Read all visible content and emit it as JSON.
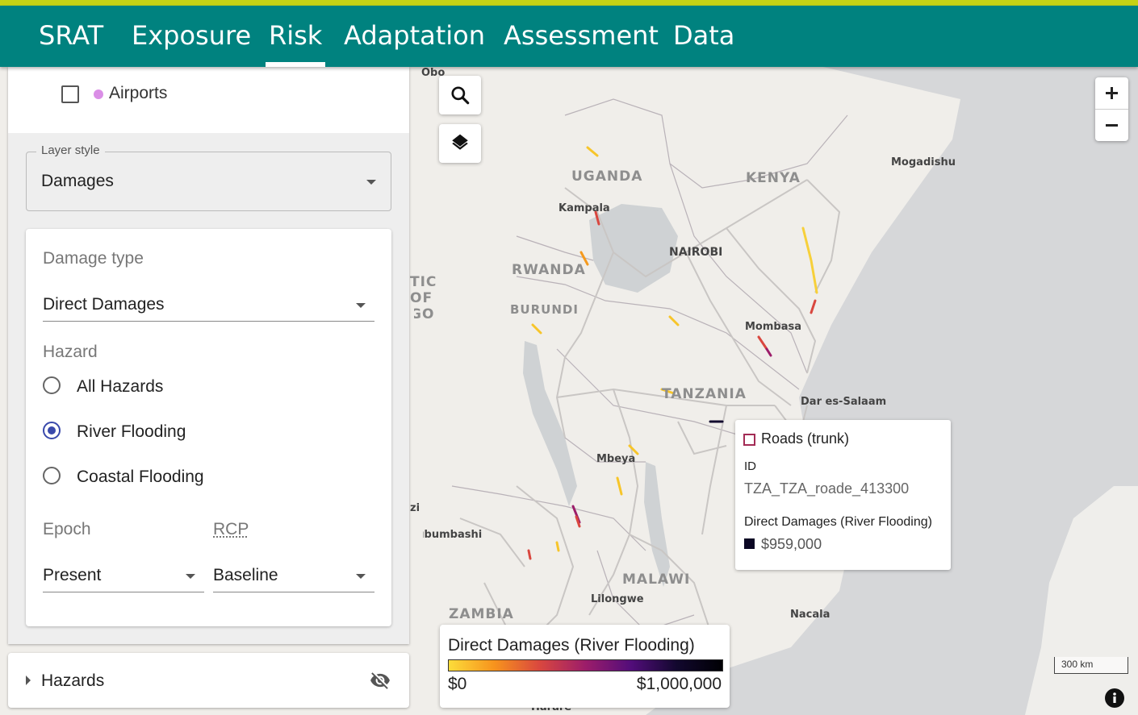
{
  "nav": {
    "items": [
      {
        "label": "SRAT"
      },
      {
        "label": "Exposure"
      },
      {
        "label": "Risk",
        "active": true
      },
      {
        "label": "Adaptation"
      },
      {
        "label": "Assessment"
      },
      {
        "label": "Data"
      }
    ]
  },
  "sidebar": {
    "airports_label": "Airports",
    "airports_checked": false,
    "layer_style": {
      "legend": "Layer style",
      "value": "Damages"
    },
    "damage_type": {
      "label": "Damage type",
      "value": "Direct Damages"
    },
    "hazard": {
      "label": "Hazard",
      "options": [
        {
          "label": "All Hazards",
          "checked": false
        },
        {
          "label": "River Flooding",
          "checked": true
        },
        {
          "label": "Coastal Flooding",
          "checked": false
        }
      ]
    },
    "epoch": {
      "label": "Epoch",
      "value": "Present"
    },
    "rcp": {
      "label": "RCP",
      "value": "Baseline"
    }
  },
  "hazards_panel": {
    "label": "Hazards",
    "visible": false
  },
  "map": {
    "countries": [
      "UGANDA",
      "KENYA",
      "RWANDA",
      "BURUNDI",
      "TANZANIA",
      "MALAWI",
      "ZAMBIA"
    ],
    "cities": [
      "Obo",
      "Kampala",
      "NAIROBI",
      "Mogadishu",
      "Mombasa",
      "Dar es-Salaam",
      "Mbeya",
      "Lilongwe",
      "Nacala",
      "Lubumbashi",
      "Harare"
    ],
    "fragments": [
      "TIC",
      "OF",
      "GO",
      "zi"
    ]
  },
  "tooltip": {
    "layer": "Roads (trunk)",
    "id_label": "ID",
    "id_value": "TZA_TZA_roade_413300",
    "metric_label": "Direct Damages (River Flooding)",
    "metric_value": "$959,000",
    "swatch_color": "#0b0724"
  },
  "legend": {
    "title": "Direct Damages (River Flooding)",
    "min_label": "$0",
    "max_label": "$1,000,000",
    "gradient": [
      "#fcdc3a",
      "#f7931d",
      "#d9473f",
      "#9c1d6a",
      "#520d7a",
      "#12082e",
      "#000004"
    ]
  },
  "scale": {
    "label": "300 km"
  },
  "colors": {
    "nav_bg": "#00827f",
    "accent_stripe": "#c6d215",
    "radio_accent": "#3949ab",
    "airport_dot": "#da8ee6"
  }
}
